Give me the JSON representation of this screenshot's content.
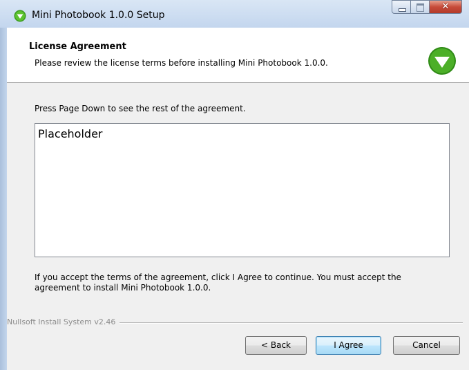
{
  "window": {
    "title": "Mini Photobook 1.0.0 Setup",
    "close_glyph": "✕"
  },
  "header": {
    "title": "License Agreement",
    "subtitle": "Please review the license terms before installing Mini Photobook 1.0.0.",
    "icon": "green-download-arrow-icon"
  },
  "body": {
    "instruction": "Press Page Down to see the rest of the agreement.",
    "license_text": "Placeholder",
    "accept_text": "If you accept the terms of the agreement, click I Agree to continue. You must accept the agreement to install Mini Photobook 1.0.0."
  },
  "footer": {
    "branding": "Nullsoft Install System v2.46",
    "back_label": "< Back",
    "agree_label": "I Agree",
    "cancel_label": "Cancel"
  },
  "colors": {
    "accent_green": "#4caf28",
    "titlebar": "#c3d6ee",
    "close_button": "#c74b3a"
  }
}
